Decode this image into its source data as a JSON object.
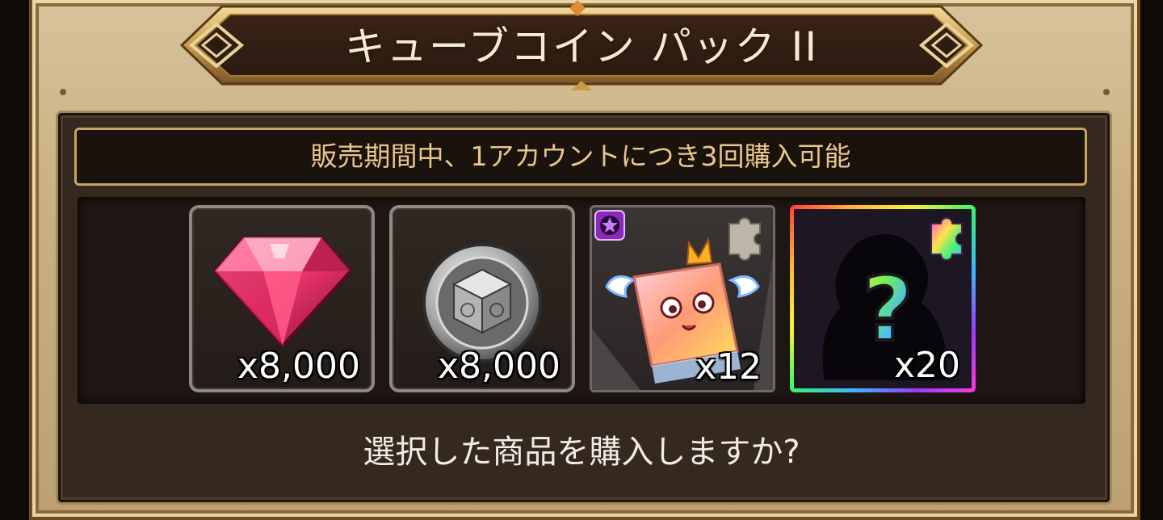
{
  "dialog": {
    "title": "キューブコイン パック II",
    "notice": "販売期間中、1アカウントにつき3回購入可能",
    "prompt": "選択した商品を購入しますか?"
  },
  "items": [
    {
      "icon": "pink-gem-icon",
      "quantity": "x8,000"
    },
    {
      "icon": "cube-coin-icon",
      "quantity": "x8,000"
    },
    {
      "icon": "winged-cube-cookie-icon",
      "quantity": "x12"
    },
    {
      "icon": "mystery-cookie-icon",
      "quantity": "x20"
    }
  ],
  "colors": {
    "frame": "#c9b083",
    "panel": "#35281f",
    "notice_text": "#e8c58a",
    "notice_border": "#c9a660"
  }
}
